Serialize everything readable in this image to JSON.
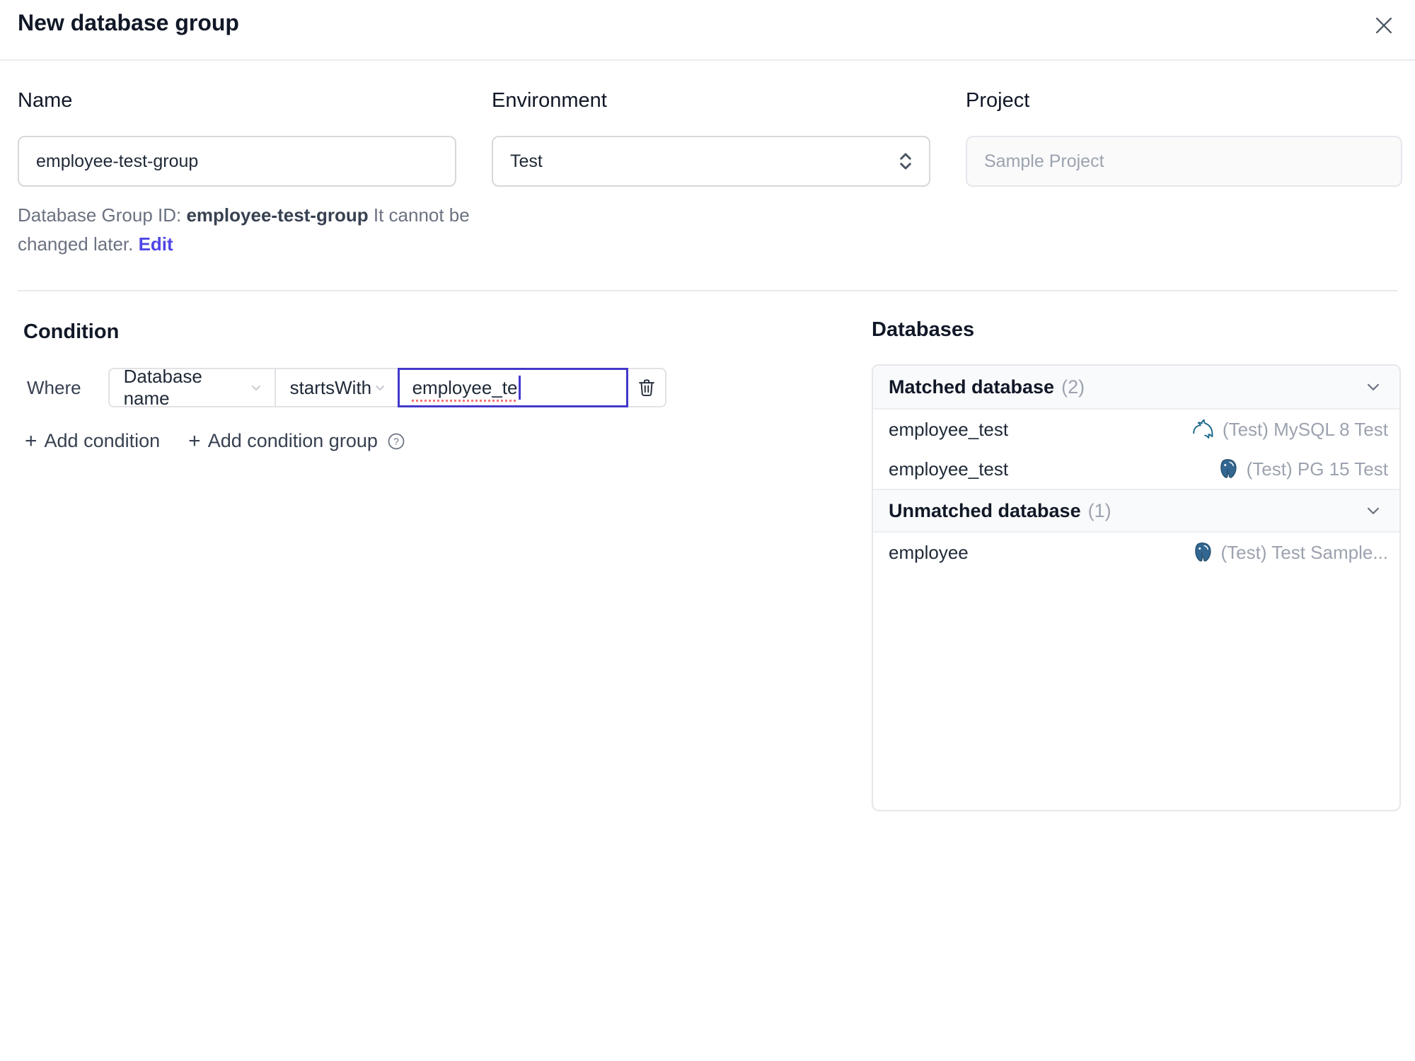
{
  "dialog": {
    "title": "New database group"
  },
  "form": {
    "name": {
      "label": "Name",
      "value": "employee-test-group"
    },
    "environment": {
      "label": "Environment",
      "value": "Test"
    },
    "project": {
      "label": "Project",
      "value": "Sample Project"
    },
    "group_id_note": {
      "prefix": "Database Group ID: ",
      "id": "employee-test-group",
      "suffix": " It cannot be changed later. ",
      "edit_label": "Edit"
    }
  },
  "condition": {
    "heading": "Condition",
    "where_label": "Where",
    "field": "Database name",
    "operator": "startsWith",
    "value": "employee_te",
    "add_condition_label": "Add condition",
    "add_condition_group_label": "Add condition group"
  },
  "databases": {
    "heading": "Databases",
    "groups": [
      {
        "title": "Matched database",
        "count": "(2)",
        "rows": [
          {
            "name": "employee_test",
            "engine": "mysql",
            "instance": "(Test) MySQL 8 Test"
          },
          {
            "name": "employee_test",
            "engine": "postgresql",
            "instance": "(Test) PG 15 Test"
          }
        ]
      },
      {
        "title": "Unmatched database",
        "count": "(1)",
        "rows": [
          {
            "name": "employee",
            "engine": "postgresql",
            "instance": "(Test) Test Sample..."
          }
        ]
      }
    ]
  },
  "colors": {
    "accent_link": "#4f46e5",
    "focus_border": "#4338ca",
    "spellcheck_underline": "#f87171",
    "mysql_icon": "#1e6a8d",
    "postgresql_icon": "#336791",
    "muted_text": "#9ca3af",
    "panel_header_bg": "#f9fafb",
    "border": "#e5e7eb"
  }
}
